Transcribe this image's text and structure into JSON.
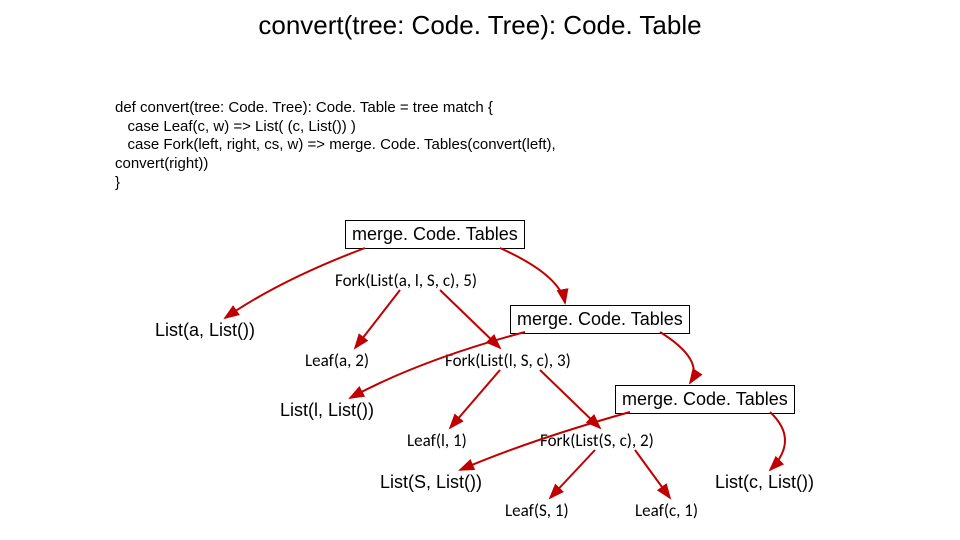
{
  "title": "convert(tree: Code. Tree): Code. Table",
  "code": {
    "l1": "def convert(tree: Code. Tree): Code. Table = tree match {",
    "l2": "   case Leaf(c, w) => List( (c, List()) )",
    "l3": "   case Fork(left, right, cs, w) => merge. Code. Tables(convert(left),",
    "l4": "convert(right))",
    "l5": "}"
  },
  "labels": {
    "merge1": "merge. Code. Tables",
    "merge2": "merge. Code. Tables",
    "merge3": "merge. Code. Tables",
    "listA": "List(a, List())",
    "listL": "List(l, List())",
    "listS": "List(S, List())",
    "listC": "List(c, List())"
  },
  "tree": {
    "n1": "Fork(List(a, l, S, c), 5)",
    "n2": "Leaf(a, 2)",
    "n3": "Fork(List(l, S, c), 3)",
    "n4": "Leaf(l, 1)",
    "n5": "Fork(List(S, c), 2)",
    "n6": "Leaf(S, 1)",
    "n7": "Leaf(c, 1)"
  }
}
